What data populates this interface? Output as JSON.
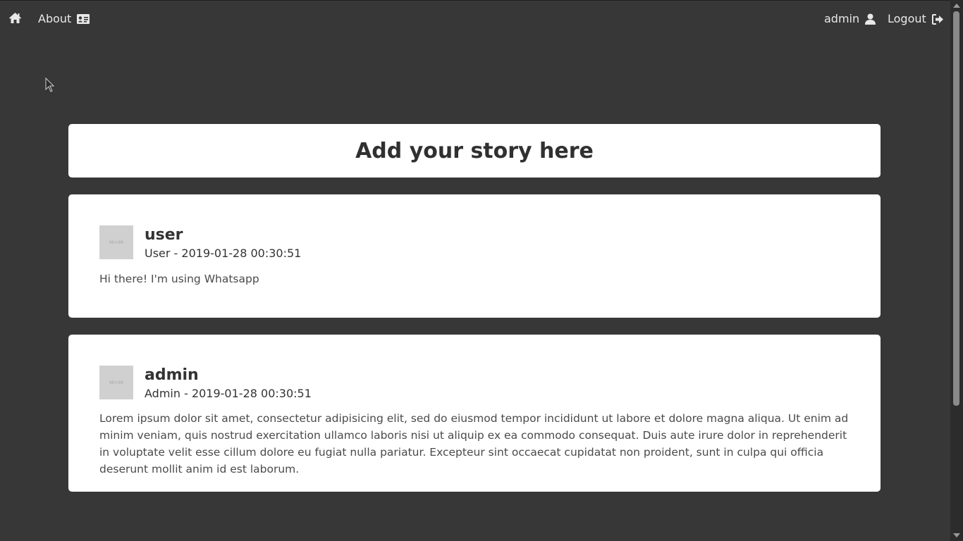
{
  "nav": {
    "about_label": "About",
    "user_label": "admin",
    "logout_label": "Logout"
  },
  "main": {
    "add_story_title": "Add your story here"
  },
  "stories": [
    {
      "username": "user",
      "role_date": "User - 2019-01-28 00:30:51",
      "text": "Hi there! I'm using Whatsapp",
      "avatar_text": "96×96"
    },
    {
      "username": "admin",
      "role_date": "Admin - 2019-01-28 00:30:51",
      "text": "Lorem ipsum dolor sit amet, consectetur adipisicing elit, sed do eiusmod tempor incididunt ut labore et dolore magna aliqua. Ut enim ad minim veniam, quis nostrud exercitation ullamco laboris nisi ut aliquip ex ea commodo consequat. Duis aute irure dolor in reprehenderit in voluptate velit esse cillum dolore eu fugiat nulla pariatur. Excepteur sint occaecat cupidatat non proident, sunt in culpa qui officia deserunt mollit anim id est laborum.",
      "avatar_text": "96×96"
    }
  ],
  "icons": {
    "home": "home-icon",
    "about": "id-card-icon",
    "user": "user-icon",
    "logout": "sign-out-icon"
  }
}
